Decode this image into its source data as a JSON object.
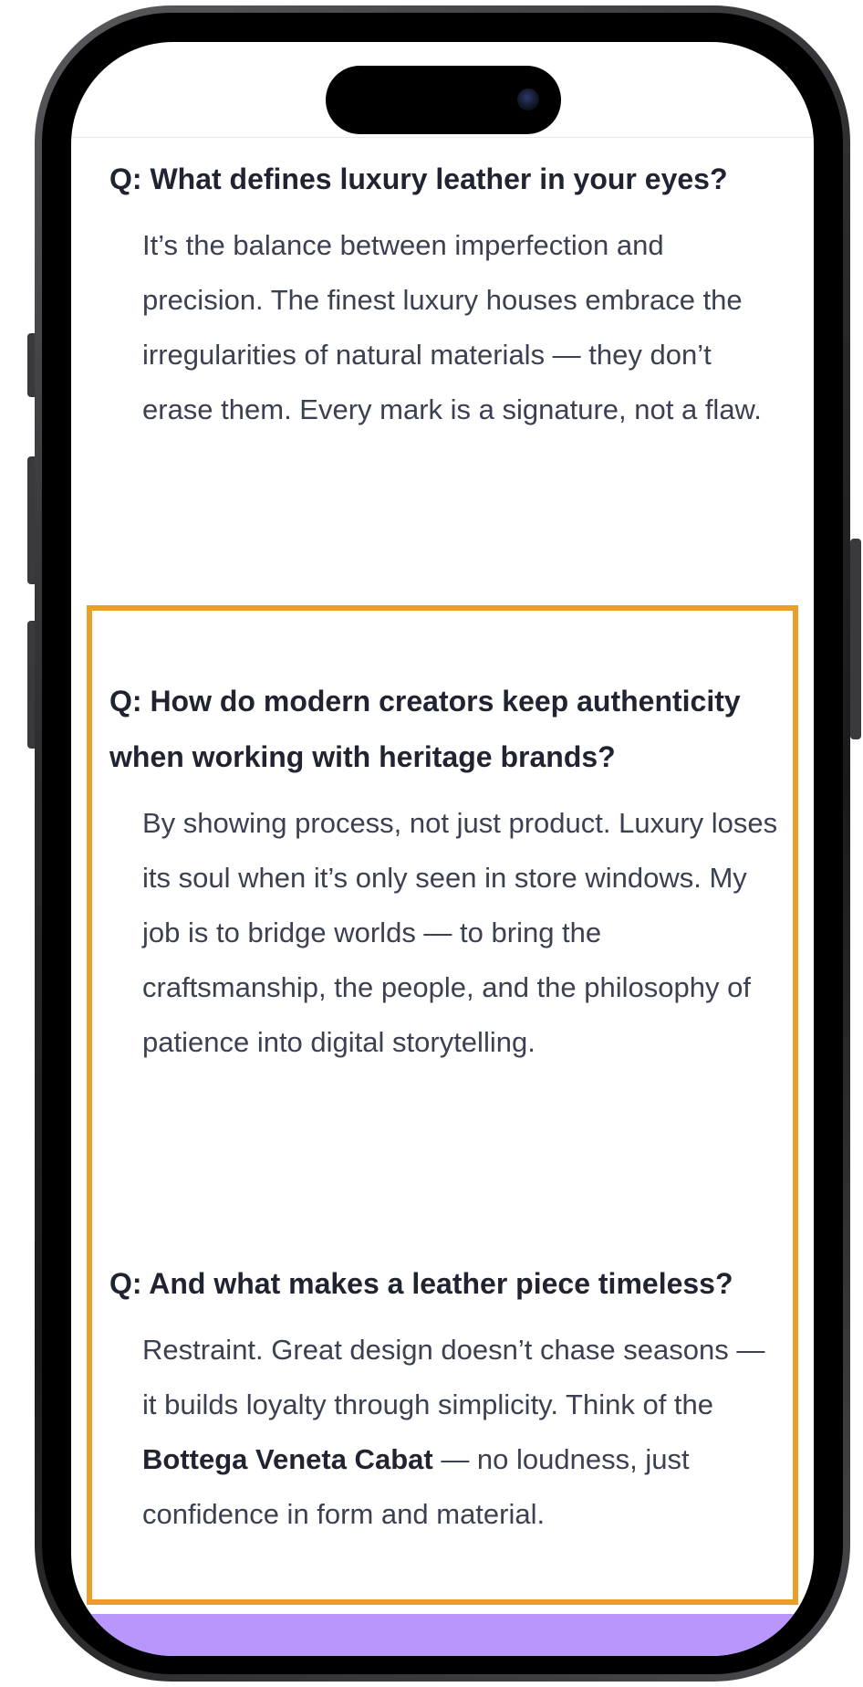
{
  "article": {
    "qa": [
      {
        "question": "Q: What defines luxury leather in your eyes?",
        "answer": "It’s the balance between imperfection and precision. The finest luxury houses embrace the irregularities of natural materials — they don’t erase them. Every mark is a signature, not a flaw."
      },
      {
        "question": "Q: How do modern creators keep authenticity when working with heritage brands?",
        "answer": "By showing process, not just product. Luxury loses its soul when it’s only seen in store windows. My job is to bridge worlds — to bring the craftsmanship, the people, and the philosophy of patience into digital storytelling."
      },
      {
        "question": "Q: And what makes a leather piece timeless?",
        "answer_before": "Restraint. Great design doesn’t chase seasons — it builds loyalty through simplicity. Think of the ",
        "answer_bold": "Bottega Veneta Cabat",
        "answer_after": " — no loudness, just confidence in form and material."
      }
    ]
  },
  "colors": {
    "highlight_border": "#e8a02a",
    "bottom_bar": "#b896fb",
    "question_text": "#1f2430",
    "answer_text": "#3b4151"
  }
}
